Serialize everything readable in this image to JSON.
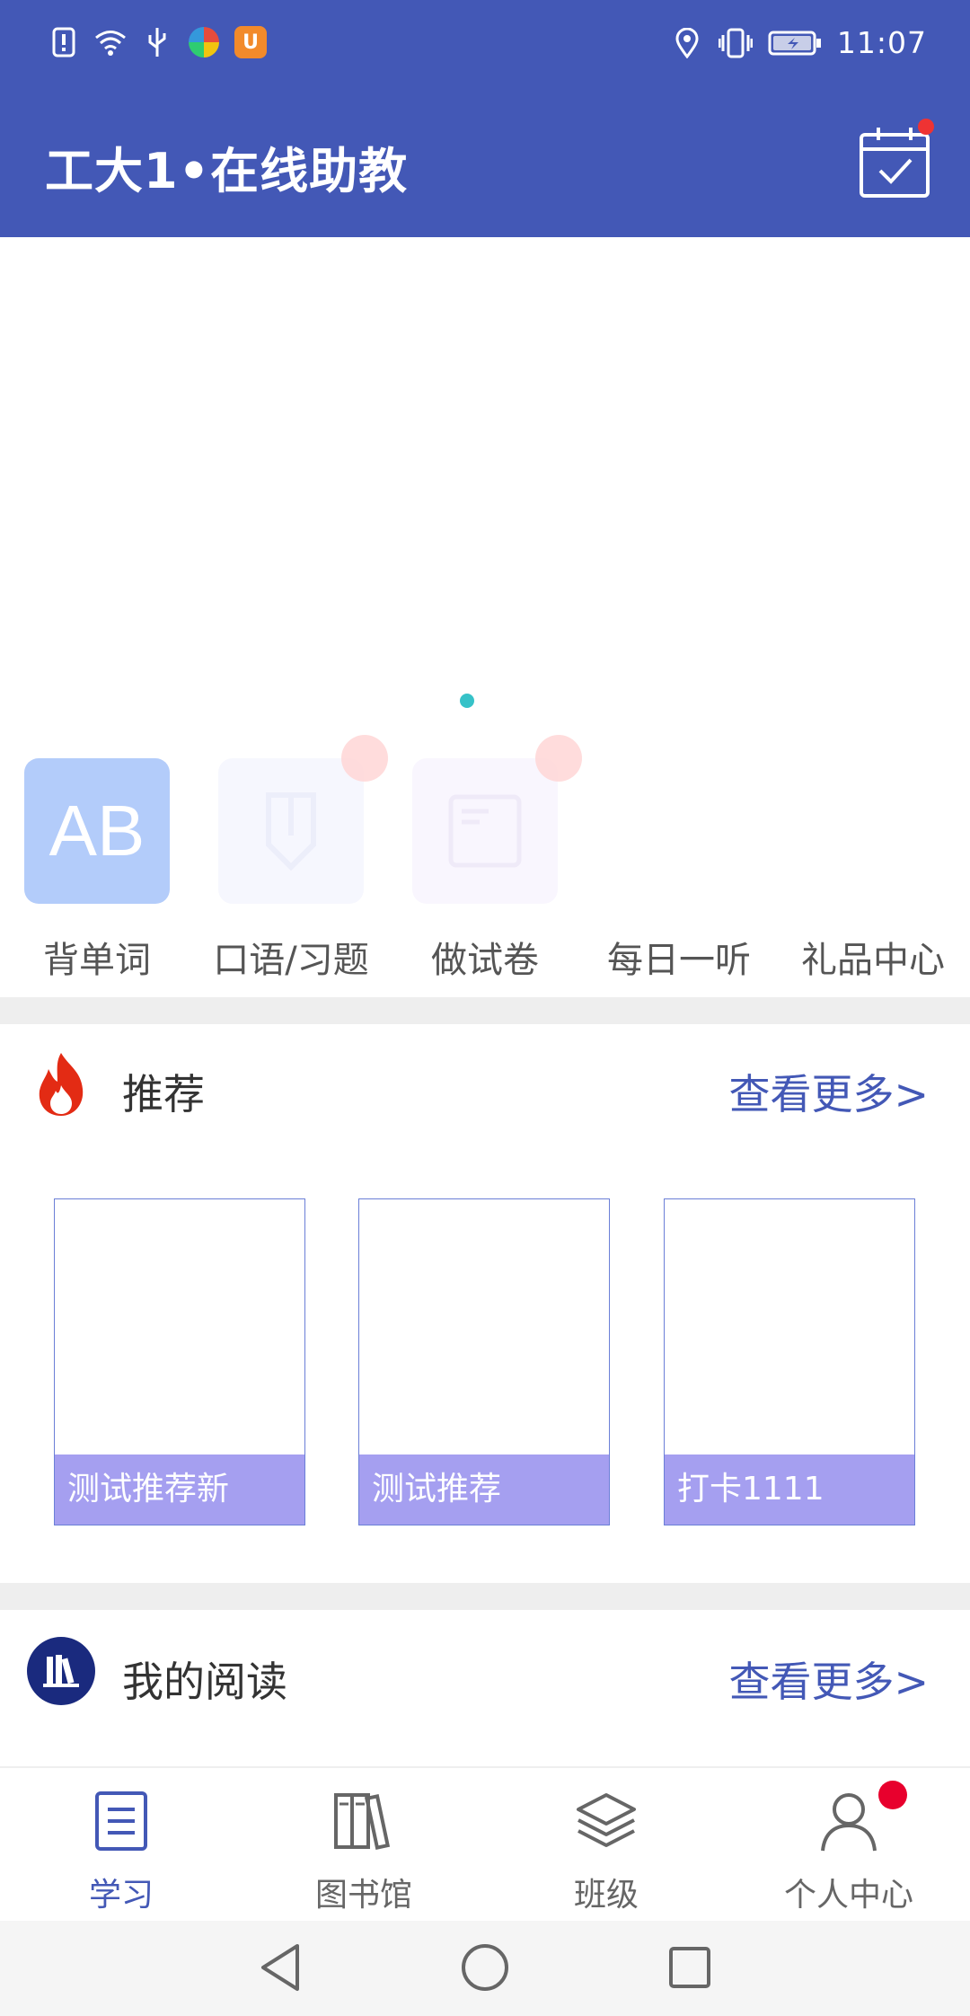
{
  "status_bar": {
    "time": "11:07",
    "left_icons": [
      "alert-icon",
      "wifi-icon",
      "usb-icon",
      "browser-app-icon",
      "uc-app-icon"
    ],
    "right_icons": [
      "location-icon",
      "vibrate-icon",
      "battery-icon"
    ]
  },
  "header": {
    "title": "工大1•在线助教",
    "color": "#4358b6",
    "calendar_has_notification": true
  },
  "quick_menu": [
    {
      "label": "背单词",
      "icon": "ab-icon"
    },
    {
      "label": "口语/习题",
      "icon": "pencil-icon"
    },
    {
      "label": "做试卷",
      "icon": "exam-icon"
    },
    {
      "label": "每日一听",
      "icon": "listen-icon"
    },
    {
      "label": "礼品中心",
      "icon": "gift-icon"
    }
  ],
  "recommend": {
    "title": "推荐",
    "more": "查看更多>",
    "cards": [
      {
        "label": "测试推荐新"
      },
      {
        "label": "测试推荐"
      },
      {
        "label": "打卡1111"
      }
    ]
  },
  "reading": {
    "title": "我的阅读",
    "more": "查看更多>"
  },
  "bottom_nav": [
    {
      "label": "学习",
      "icon": "study-icon",
      "active": true
    },
    {
      "label": "图书馆",
      "icon": "library-icon",
      "active": false
    },
    {
      "label": "班级",
      "icon": "class-icon",
      "active": false
    },
    {
      "label": "个人中心",
      "icon": "profile-icon",
      "active": false
    }
  ],
  "colors": {
    "primary": "#4358b6",
    "card_label_bg": "#a59ff0",
    "banner_indicator": "#36c2c8",
    "notification": "#e8002d"
  }
}
